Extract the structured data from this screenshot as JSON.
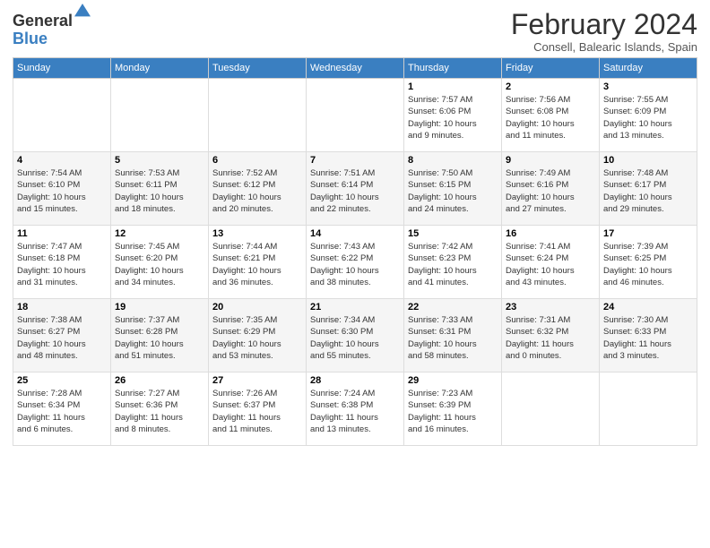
{
  "logo": {
    "general": "General",
    "blue": "Blue"
  },
  "title": "February 2024",
  "subtitle": "Consell, Balearic Islands, Spain",
  "days_header": [
    "Sunday",
    "Monday",
    "Tuesday",
    "Wednesday",
    "Thursday",
    "Friday",
    "Saturday"
  ],
  "weeks": [
    [
      {
        "day": "",
        "info": ""
      },
      {
        "day": "",
        "info": ""
      },
      {
        "day": "",
        "info": ""
      },
      {
        "day": "",
        "info": ""
      },
      {
        "day": "1",
        "info": "Sunrise: 7:57 AM\nSunset: 6:06 PM\nDaylight: 10 hours\nand 9 minutes."
      },
      {
        "day": "2",
        "info": "Sunrise: 7:56 AM\nSunset: 6:08 PM\nDaylight: 10 hours\nand 11 minutes."
      },
      {
        "day": "3",
        "info": "Sunrise: 7:55 AM\nSunset: 6:09 PM\nDaylight: 10 hours\nand 13 minutes."
      }
    ],
    [
      {
        "day": "4",
        "info": "Sunrise: 7:54 AM\nSunset: 6:10 PM\nDaylight: 10 hours\nand 15 minutes."
      },
      {
        "day": "5",
        "info": "Sunrise: 7:53 AM\nSunset: 6:11 PM\nDaylight: 10 hours\nand 18 minutes."
      },
      {
        "day": "6",
        "info": "Sunrise: 7:52 AM\nSunset: 6:12 PM\nDaylight: 10 hours\nand 20 minutes."
      },
      {
        "day": "7",
        "info": "Sunrise: 7:51 AM\nSunset: 6:14 PM\nDaylight: 10 hours\nand 22 minutes."
      },
      {
        "day": "8",
        "info": "Sunrise: 7:50 AM\nSunset: 6:15 PM\nDaylight: 10 hours\nand 24 minutes."
      },
      {
        "day": "9",
        "info": "Sunrise: 7:49 AM\nSunset: 6:16 PM\nDaylight: 10 hours\nand 27 minutes."
      },
      {
        "day": "10",
        "info": "Sunrise: 7:48 AM\nSunset: 6:17 PM\nDaylight: 10 hours\nand 29 minutes."
      }
    ],
    [
      {
        "day": "11",
        "info": "Sunrise: 7:47 AM\nSunset: 6:18 PM\nDaylight: 10 hours\nand 31 minutes."
      },
      {
        "day": "12",
        "info": "Sunrise: 7:45 AM\nSunset: 6:20 PM\nDaylight: 10 hours\nand 34 minutes."
      },
      {
        "day": "13",
        "info": "Sunrise: 7:44 AM\nSunset: 6:21 PM\nDaylight: 10 hours\nand 36 minutes."
      },
      {
        "day": "14",
        "info": "Sunrise: 7:43 AM\nSunset: 6:22 PM\nDaylight: 10 hours\nand 38 minutes."
      },
      {
        "day": "15",
        "info": "Sunrise: 7:42 AM\nSunset: 6:23 PM\nDaylight: 10 hours\nand 41 minutes."
      },
      {
        "day": "16",
        "info": "Sunrise: 7:41 AM\nSunset: 6:24 PM\nDaylight: 10 hours\nand 43 minutes."
      },
      {
        "day": "17",
        "info": "Sunrise: 7:39 AM\nSunset: 6:25 PM\nDaylight: 10 hours\nand 46 minutes."
      }
    ],
    [
      {
        "day": "18",
        "info": "Sunrise: 7:38 AM\nSunset: 6:27 PM\nDaylight: 10 hours\nand 48 minutes."
      },
      {
        "day": "19",
        "info": "Sunrise: 7:37 AM\nSunset: 6:28 PM\nDaylight: 10 hours\nand 51 minutes."
      },
      {
        "day": "20",
        "info": "Sunrise: 7:35 AM\nSunset: 6:29 PM\nDaylight: 10 hours\nand 53 minutes."
      },
      {
        "day": "21",
        "info": "Sunrise: 7:34 AM\nSunset: 6:30 PM\nDaylight: 10 hours\nand 55 minutes."
      },
      {
        "day": "22",
        "info": "Sunrise: 7:33 AM\nSunset: 6:31 PM\nDaylight: 10 hours\nand 58 minutes."
      },
      {
        "day": "23",
        "info": "Sunrise: 7:31 AM\nSunset: 6:32 PM\nDaylight: 11 hours\nand 0 minutes."
      },
      {
        "day": "24",
        "info": "Sunrise: 7:30 AM\nSunset: 6:33 PM\nDaylight: 11 hours\nand 3 minutes."
      }
    ],
    [
      {
        "day": "25",
        "info": "Sunrise: 7:28 AM\nSunset: 6:34 PM\nDaylight: 11 hours\nand 6 minutes."
      },
      {
        "day": "26",
        "info": "Sunrise: 7:27 AM\nSunset: 6:36 PM\nDaylight: 11 hours\nand 8 minutes."
      },
      {
        "day": "27",
        "info": "Sunrise: 7:26 AM\nSunset: 6:37 PM\nDaylight: 11 hours\nand 11 minutes."
      },
      {
        "day": "28",
        "info": "Sunrise: 7:24 AM\nSunset: 6:38 PM\nDaylight: 11 hours\nand 13 minutes."
      },
      {
        "day": "29",
        "info": "Sunrise: 7:23 AM\nSunset: 6:39 PM\nDaylight: 11 hours\nand 16 minutes."
      },
      {
        "day": "",
        "info": ""
      },
      {
        "day": "",
        "info": ""
      }
    ]
  ]
}
